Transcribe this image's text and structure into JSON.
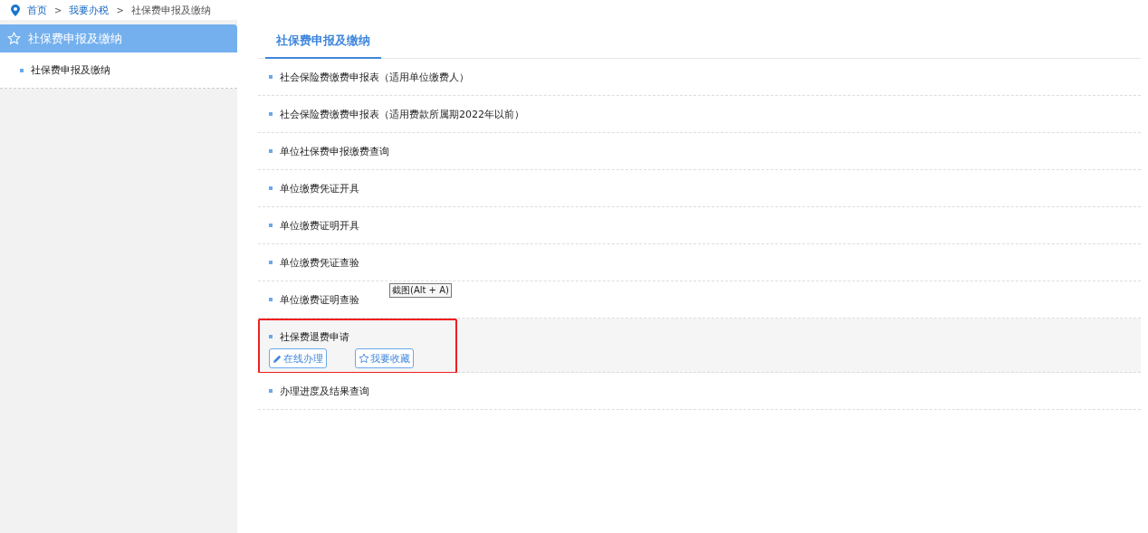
{
  "breadcrumb": [
    {
      "label": "首页",
      "link": true
    },
    {
      "label": "我要办税",
      "link": true
    },
    {
      "label": "社保费申报及缴纳",
      "link": false
    }
  ],
  "breadcrumb_separator": ">",
  "sidebar": {
    "title": "社保费申报及缴纳",
    "items": [
      {
        "label": "社保费申报及缴纳",
        "selected": false
      }
    ]
  },
  "tabs": [
    {
      "label": "社保费申报及缴纳",
      "selected": true
    }
  ],
  "items": [
    {
      "label": "社会保险费缴费申报表（适用单位缴费人）",
      "expanded": false,
      "highlighted": false
    },
    {
      "label": "社会保险费缴费申报表（适用费款所属期2022年以前）",
      "expanded": false,
      "highlighted": false
    },
    {
      "label": "单位社保费申报缴费查询",
      "expanded": false,
      "highlighted": false
    },
    {
      "label": "单位缴费凭证开具",
      "expanded": false,
      "highlighted": false
    },
    {
      "label": "单位缴费证明开具",
      "expanded": false,
      "highlighted": false
    },
    {
      "label": "单位缴费凭证查验",
      "expanded": false,
      "highlighted": false
    },
    {
      "label": "单位缴费证明查验",
      "expanded": false,
      "highlighted": false,
      "tooltip": "截图(Alt + A)"
    },
    {
      "label": "社保费退费申请",
      "expanded": true,
      "highlighted": true,
      "actions": [
        {
          "label": "在线办理",
          "kind": "edit"
        },
        {
          "label": "我要收藏",
          "kind": "favorite"
        }
      ]
    },
    {
      "label": "办理进度及结果查询",
      "expanded": false,
      "highlighted": false
    }
  ]
}
